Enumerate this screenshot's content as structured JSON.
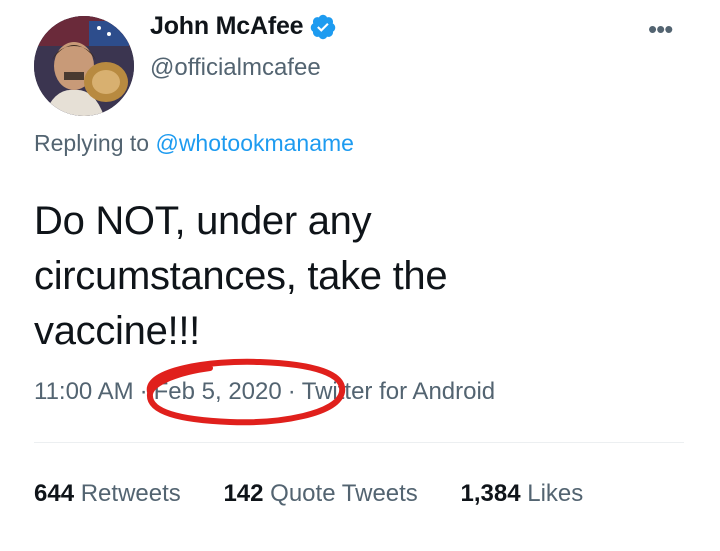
{
  "author": {
    "display_name": "John McAfee",
    "handle": "@officialmcafee",
    "verified": true,
    "verified_icon": "verified-badge-icon",
    "avatar_icon": "profile-photo"
  },
  "menu": {
    "more_label": "•••"
  },
  "reply": {
    "prefix": "Replying to",
    "to_handle": "@whotookmaname"
  },
  "tweet": {
    "text": "Do NOT, under any circumstances, take the vaccine!!!"
  },
  "meta": {
    "time": "11:00 AM",
    "separator": "·",
    "date": "Feb 5, 2020",
    "source": "Twitter for Android"
  },
  "stats": {
    "retweets_count": "644",
    "retweets_label": "Retweets",
    "quote_count": "142",
    "quote_label": "Quote Tweets",
    "likes_count": "1,384",
    "likes_label": "Likes"
  },
  "colors": {
    "accent": "#1d9bf0",
    "secondary_text": "#536471",
    "primary_text": "#0f1419",
    "annotation_red": "#e0201c"
  }
}
